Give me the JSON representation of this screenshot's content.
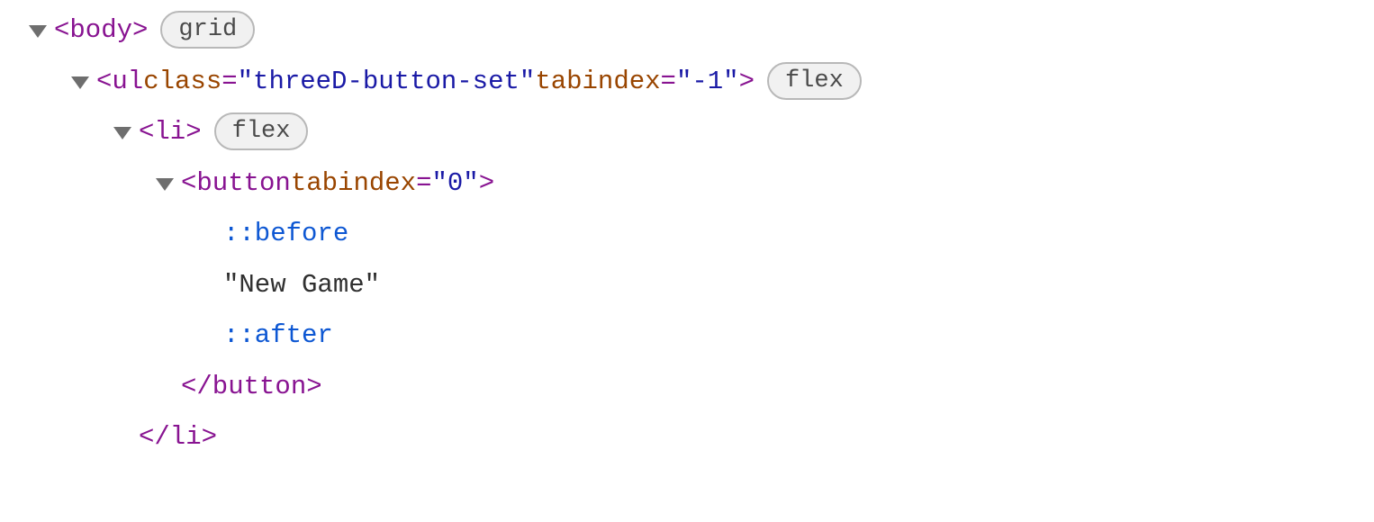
{
  "tree": {
    "row0": {
      "tag_open": "<body>",
      "badge": "grid"
    },
    "row1": {
      "tag_open_start": "<ul",
      "attr1_name": " class",
      "attr1_eq": "=",
      "attr1_q1": "\"",
      "attr1_val": "threeD-button-set",
      "attr1_q2": "\"",
      "attr2_name": " tabindex",
      "attr2_eq": "=",
      "attr2_q1": "\"",
      "attr2_val": "-1",
      "attr2_q2": "\"",
      "tag_open_end": ">",
      "badge": "flex"
    },
    "row2": {
      "tag_open": "<li>",
      "badge": "flex"
    },
    "row3": {
      "tag_open_start": "<button",
      "attr1_name": " tabindex",
      "attr1_eq": "=",
      "attr1_q1": "\"",
      "attr1_val": "0",
      "attr1_q2": "\"",
      "tag_open_end": ">"
    },
    "row4": {
      "pseudo": "::before"
    },
    "row5": {
      "text": "\"New Game\""
    },
    "row6": {
      "pseudo": "::after"
    },
    "row7": {
      "tag_close": "</button>"
    },
    "row8": {
      "tag_close": "</li>"
    }
  }
}
